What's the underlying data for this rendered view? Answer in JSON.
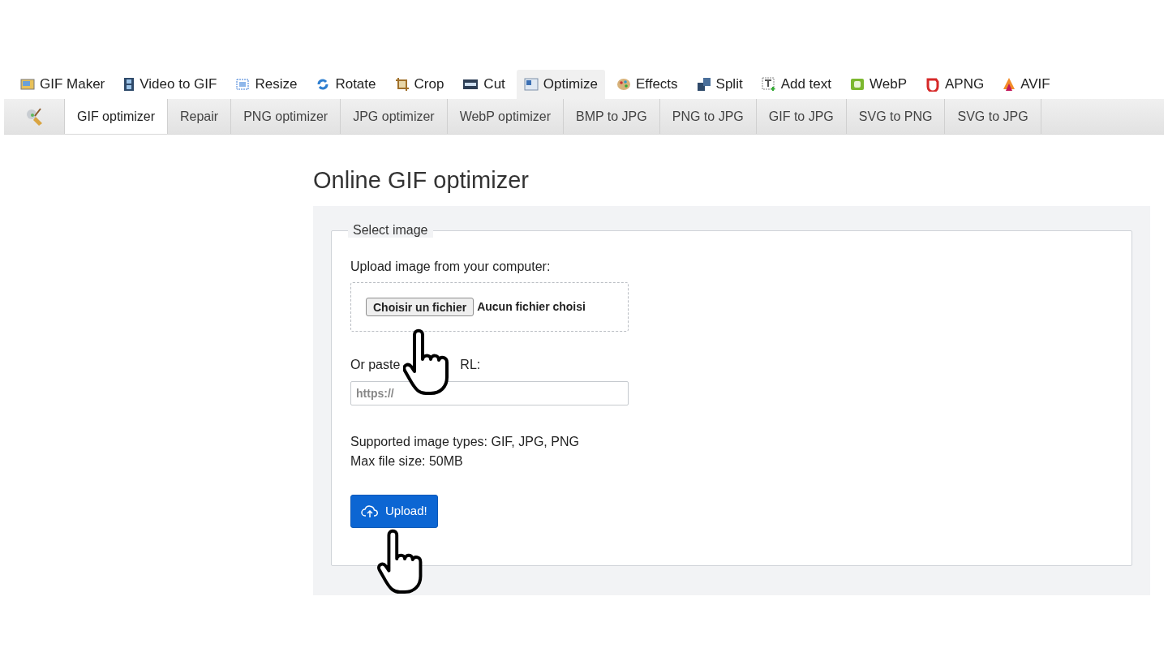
{
  "main_tabs": [
    {
      "label": "GIF Maker",
      "selected": false
    },
    {
      "label": "Video to GIF",
      "selected": false
    },
    {
      "label": "Resize",
      "selected": false
    },
    {
      "label": "Rotate",
      "selected": false
    },
    {
      "label": "Crop",
      "selected": false
    },
    {
      "label": "Cut",
      "selected": false
    },
    {
      "label": "Optimize",
      "selected": true
    },
    {
      "label": "Effects",
      "selected": false
    },
    {
      "label": "Split",
      "selected": false
    },
    {
      "label": "Add text",
      "selected": false
    },
    {
      "label": "WebP",
      "selected": false
    },
    {
      "label": "APNG",
      "selected": false
    },
    {
      "label": "AVIF",
      "selected": false
    }
  ],
  "sub_tabs": [
    {
      "label": "GIF optimizer",
      "selected": true
    },
    {
      "label": "Repair",
      "selected": false
    },
    {
      "label": "PNG optimizer",
      "selected": false
    },
    {
      "label": "JPG optimizer",
      "selected": false
    },
    {
      "label": "WebP optimizer",
      "selected": false
    },
    {
      "label": "BMP to JPG",
      "selected": false
    },
    {
      "label": "PNG to JPG",
      "selected": false
    },
    {
      "label": "GIF to JPG",
      "selected": false
    },
    {
      "label": "SVG to PNG",
      "selected": false
    },
    {
      "label": "SVG to JPG",
      "selected": false
    }
  ],
  "title": "Online GIF optimizer",
  "form": {
    "legend": "Select image",
    "upload_label": "Upload image from your computer:",
    "file_button": "Choisir un fichier",
    "file_status": "Aucun fichier choisi",
    "url_label_start": "Or paste",
    "url_label_end": "RL:",
    "url_placeholder": "https://",
    "info_lines": [
      "Supported image types: GIF, JPG, PNG",
      "Max file size: 50MB"
    ],
    "submit": "Upload!"
  }
}
